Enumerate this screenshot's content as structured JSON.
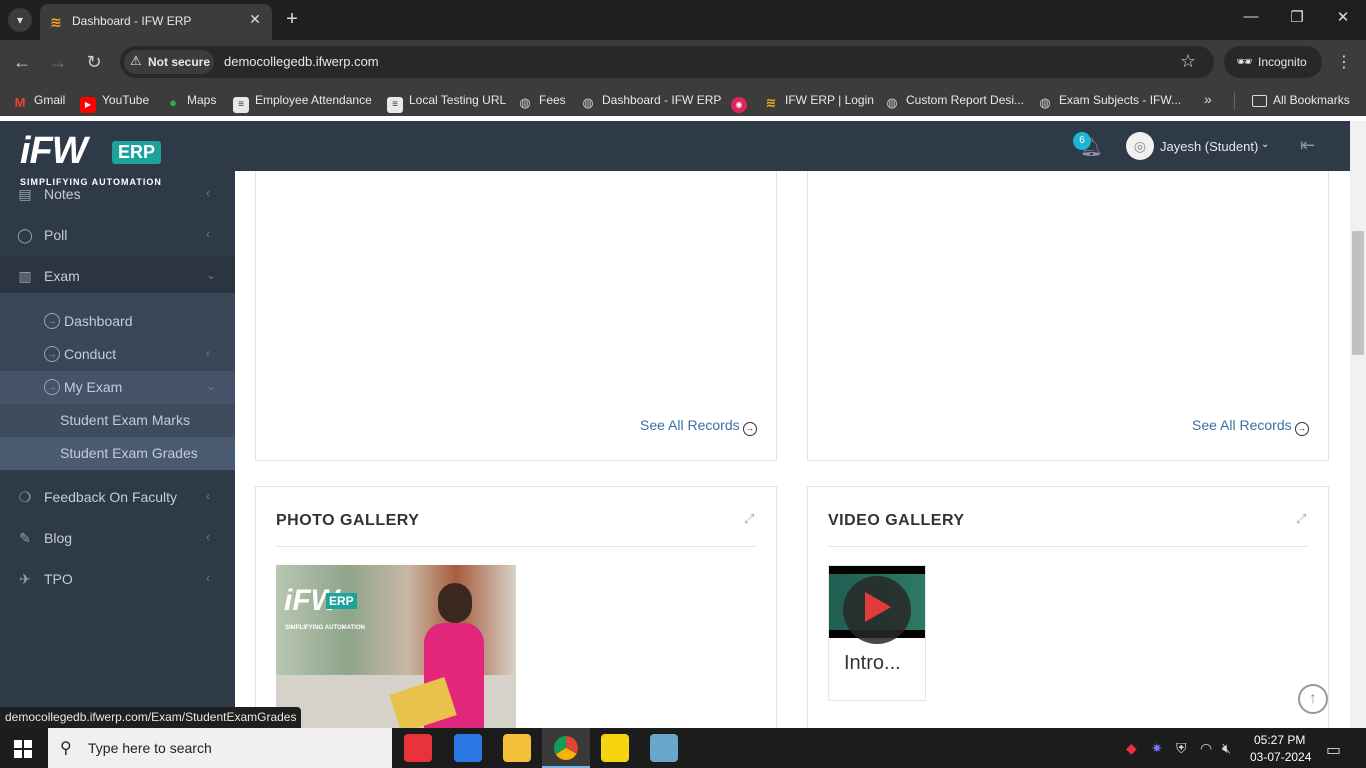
{
  "browser": {
    "tab_title": "Dashboard - IFW ERP",
    "security_label": "Not secure",
    "url": "democollegedb.ifwerp.com",
    "profile_label": "Incognito",
    "status_url": "democollegedb.ifwerp.com/Exam/StudentExamGrades",
    "bookmarks": [
      {
        "label": "Gmail",
        "icon": "gmail-icon",
        "color": "#ea4335"
      },
      {
        "label": "YouTube",
        "icon": "youtube-icon",
        "color": "#ff0000"
      },
      {
        "label": "Maps",
        "icon": "maps-icon",
        "color": "#34a853"
      },
      {
        "label": "Employee Attendance",
        "icon": "doc-icon",
        "color": "#e8e8e8"
      },
      {
        "label": "Local Testing URL",
        "icon": "doc-icon",
        "color": "#e8e8e8"
      },
      {
        "label": "Fees",
        "icon": "globe-icon",
        "color": "#e8e8e8"
      },
      {
        "label": "Dashboard - IFW ERP",
        "icon": "globe-icon",
        "color": "#e8e8e8"
      },
      {
        "label": "",
        "icon": "app-icon",
        "color": "#e0245e"
      },
      {
        "label": "IFW ERP | Login",
        "icon": "ifw-icon",
        "color": "#f5a623"
      },
      {
        "label": "Custom Report Desi...",
        "icon": "globe-icon",
        "color": "#e8e8e8"
      },
      {
        "label": "Exam Subjects - IFW...",
        "icon": "globe-icon",
        "color": "#e8e8e8"
      }
    ],
    "all_bookmarks_label": "All Bookmarks"
  },
  "header": {
    "logo_main": "iFW",
    "logo_badge": "ERP",
    "logo_tagline": "SIMPLIFYING AUTOMATION",
    "notification_count": "6",
    "user_name": "Jayesh (Student)"
  },
  "sidebar": {
    "items": [
      {
        "label": "Notes"
      },
      {
        "label": "Poll"
      },
      {
        "label": "Exam"
      },
      {
        "label": "Feedback On Faculty"
      },
      {
        "label": "Blog"
      },
      {
        "label": "TPO"
      }
    ],
    "exam_sub": [
      {
        "label": "Dashboard"
      },
      {
        "label": "Conduct"
      },
      {
        "label": "My Exam"
      }
    ],
    "my_exam_sub": [
      {
        "label": "Student Exam Marks"
      },
      {
        "label": "Student Exam Grades"
      }
    ]
  },
  "main": {
    "see_all_left": "See All Records",
    "see_all_right": "See All Records",
    "photo_gallery_title": "PHOTO GALLERY",
    "video_gallery_title": "VIDEO GALLERY",
    "photo_logo": "iFW",
    "photo_logo_badge": "ERP",
    "photo_tagline": "SIMPLIFYING AUTOMATION",
    "video_caption": "Intro..."
  },
  "taskbar": {
    "search_placeholder": "Type here to search",
    "time": "05:27 PM",
    "date": "03-07-2024"
  },
  "colors": {
    "sidebar_bg": "#2e3a47",
    "sidebar_active": "#3a4756",
    "accent": "#1ba39c",
    "link": "#3c6ea5"
  }
}
